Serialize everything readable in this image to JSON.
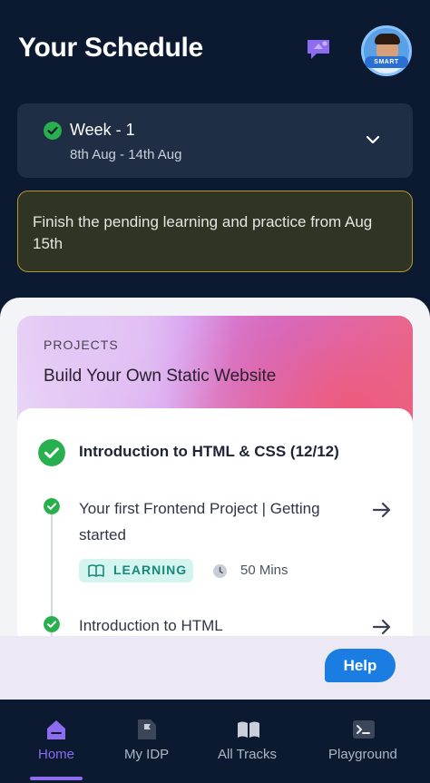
{
  "header": {
    "title": "Your Schedule",
    "avatar_badge": "SMART",
    "chat_icon": "chat-bubble-icon"
  },
  "week": {
    "title": "Week - 1",
    "dates": "8th Aug - 14th Aug",
    "completed": true
  },
  "notice": {
    "text": "Finish the pending learning and practice from Aug 15th"
  },
  "project": {
    "label": "PROJECTS",
    "title": "Build Your Own Static Website",
    "module": {
      "title": "Introduction to HTML & CSS (12/12)",
      "lessons": [
        {
          "title": "Your first Frontend Project | Getting started",
          "tag": "LEARNING",
          "duration": "50 Mins"
        },
        {
          "title": "Introduction to HTML"
        }
      ]
    }
  },
  "help": {
    "label": "Help"
  },
  "nav": {
    "items": [
      {
        "label": "Home",
        "icon": "home-icon",
        "active": true
      },
      {
        "label": "My IDP",
        "icon": "flag-document-icon",
        "active": false
      },
      {
        "label": "All Tracks",
        "icon": "open-book-icon",
        "active": false
      },
      {
        "label": "Playground",
        "icon": "terminal-icon",
        "active": false
      }
    ]
  },
  "colors": {
    "background": "#0b1a30",
    "accent": "#8d6cf0",
    "success": "#27b04d",
    "help": "#1b7de2",
    "notice_border": "#b7962d"
  }
}
